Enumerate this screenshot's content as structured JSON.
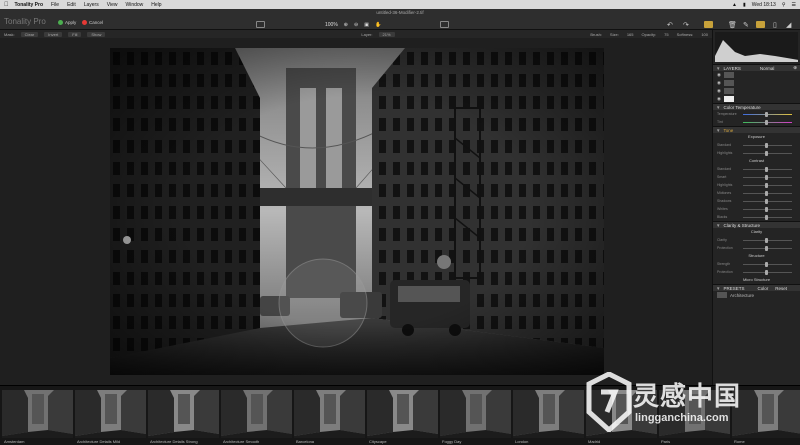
{
  "menubar": {
    "app_name": "Tonality Pro",
    "items": [
      "File",
      "Edit",
      "Layers",
      "View",
      "Window",
      "Help"
    ],
    "clock": "Wed 18:13"
  },
  "window": {
    "title": "untitled-36-Modifier-2.tif"
  },
  "toolbar": {
    "logo": "Tonality Pro",
    "apply_label": "Apply",
    "cancel_label": "Cancel",
    "zoom_level": "100%"
  },
  "options": {
    "mask_label": "Mask:",
    "clear": "Clear",
    "invert": "Invert",
    "fill": "Fill",
    "show": "Show",
    "layer_label": "Layer:",
    "layer_value": "21%",
    "brush_label": "Brush:",
    "size_label": "Size:",
    "size_value": "165",
    "opacity_label": "Opacity:",
    "opacity_value": "75",
    "softness_label": "Softness:",
    "softness_value": "100"
  },
  "panel": {
    "layers_title": "LAYERS",
    "blend_mode": "Normal",
    "color_temp_title": "Color Temperature",
    "temperature_label": "Temperature",
    "tint_label": "Tint",
    "tone_title": "Tone",
    "exposure_label": "Exposure",
    "standard_label": "Standard",
    "highlights_label": "Highlights",
    "contrast_label": "Contrast",
    "standard2_label": "Standard",
    "smart_label": "Smart",
    "highlights2_label": "Highlights",
    "midtones_label": "Midtones",
    "shadows_label": "Shadows",
    "whites_label": "Whites",
    "blacks_label": "Blacks",
    "clarity_title": "Clarity & Structure",
    "clarity_label": "Clarity",
    "clarity_protection": "Protection",
    "structure_label": "Structure",
    "structure_strength": "Strength",
    "structure_protection": "Protection",
    "micro_label": "Micro Structure",
    "presets_title": "PRESETS",
    "presets_color": "Color",
    "presets_reset": "Reset",
    "preset_category": "Architecture"
  },
  "presets": [
    "Amsterdam",
    "Architecture Details Mild",
    "Architecture Details Strong",
    "Architecture Smooth",
    "Barcelona",
    "Cityscape",
    "Foggy Day",
    "London",
    "Madrid",
    "Paris",
    "Rome"
  ],
  "watermark": {
    "text": "灵感中国",
    "url": "lingganchina.com"
  },
  "colors": {
    "accent": "#c7a13a",
    "apply_dot": "#4caf50",
    "cancel_dot": "#e53935"
  }
}
